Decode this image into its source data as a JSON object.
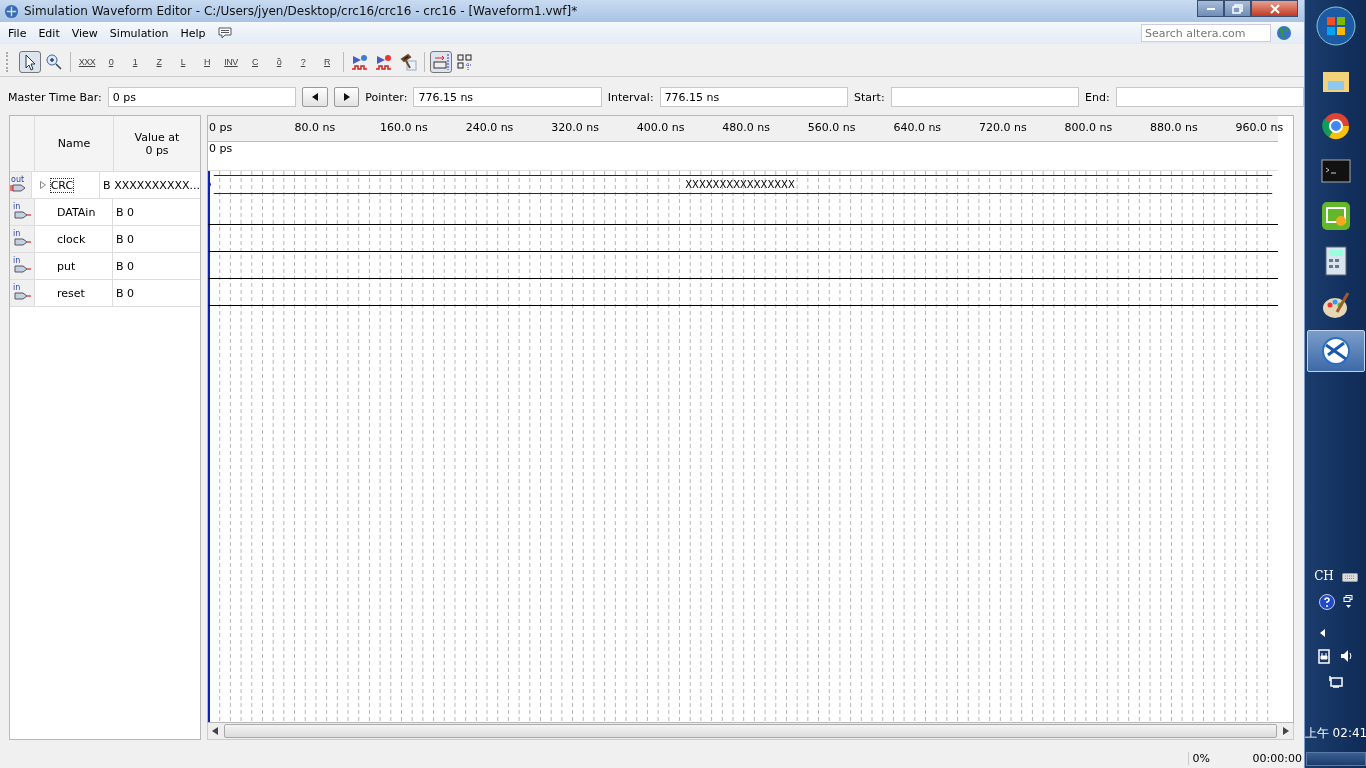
{
  "window": {
    "title": "Simulation Waveform Editor - C:/Users/jyen/Desktop/crc16/crc16 - crc16 - [Waveform1.vwf]*"
  },
  "menu": [
    "File",
    "Edit",
    "View",
    "Simulation",
    "Help"
  ],
  "search": {
    "placeholder": "Search altera.com"
  },
  "toolbar": [
    {
      "kind": "pointer",
      "selected": true
    },
    {
      "kind": "zoom",
      "selected": false
    },
    {
      "kind": "sep"
    },
    {
      "kind": "glyph",
      "glyph": "XXX",
      "selected": false
    },
    {
      "kind": "glyph",
      "glyph": "0",
      "selected": false
    },
    {
      "kind": "glyph",
      "glyph": "1",
      "selected": false
    },
    {
      "kind": "glyph",
      "glyph": "Z",
      "selected": false
    },
    {
      "kind": "glyph",
      "glyph": "L",
      "selected": false
    },
    {
      "kind": "glyph",
      "glyph": "H",
      "selected": false
    },
    {
      "kind": "glyph",
      "glyph": "INV",
      "selected": false
    },
    {
      "kind": "glyph",
      "glyph": "C",
      "selected": false
    },
    {
      "kind": "glyph",
      "glyph": "ȍ",
      "selected": false
    },
    {
      "kind": "glyph",
      "glyph": "?",
      "selected": false
    },
    {
      "kind": "glyph",
      "glyph": "R",
      "selected": false
    },
    {
      "kind": "sep"
    },
    {
      "kind": "run",
      "selected": false
    },
    {
      "kind": "run-timing",
      "selected": false
    },
    {
      "kind": "hammer",
      "selected": false
    },
    {
      "kind": "sep"
    },
    {
      "kind": "snap",
      "selected": true
    },
    {
      "kind": "grid",
      "selected": false
    }
  ],
  "timebar": {
    "master_label": "Master Time Bar:",
    "master_value": "0 ps",
    "pointer_label": "Pointer:",
    "pointer_value": "776.15 ns",
    "interval_label": "Interval:",
    "interval_value": "776.15 ns",
    "start_label": "Start:",
    "end_label": "End:"
  },
  "signals_header": {
    "name": "Name",
    "value_at": "Value at",
    "value_time": "0 ps"
  },
  "signals": [
    {
      "direction": "out",
      "name": "CRC",
      "value": "B XXXXXXXXXX...",
      "expandable": true,
      "selected": true,
      "kind": "bus",
      "wave_text": "XXXXXXXXXXXXXXXX"
    },
    {
      "direction": "in",
      "name": "DATAin",
      "value": "B 0",
      "expandable": false,
      "selected": false,
      "kind": "bit"
    },
    {
      "direction": "in",
      "name": "clock",
      "value": "B 0",
      "expandable": false,
      "selected": false,
      "kind": "bit"
    },
    {
      "direction": "in",
      "name": "put",
      "value": "B 0",
      "expandable": false,
      "selected": false,
      "kind": "bit"
    },
    {
      "direction": "in",
      "name": "reset",
      "value": "B 0",
      "expandable": false,
      "selected": false,
      "kind": "bit"
    }
  ],
  "ruler": [
    "0 ps",
    "80.0 ns",
    "160.0 ns",
    "240.0 ns",
    "320.0 ns",
    "400.0 ns",
    "480.0 ns",
    "560.0 ns",
    "640.0 ns",
    "720.0 ns",
    "800.0 ns",
    "880.0 ns",
    "960.0 ns"
  ],
  "time_marker": "0 ps",
  "status_bar": {
    "progress": "0%",
    "elapsed": "00:00:00"
  },
  "taskbar": {
    "apps": [
      {
        "kind": "folder",
        "selected": false
      },
      {
        "kind": "browser",
        "selected": false
      },
      {
        "kind": "console",
        "selected": false
      },
      {
        "kind": "video",
        "selected": false
      },
      {
        "kind": "calculator",
        "selected": false
      },
      {
        "kind": "paint",
        "selected": false
      },
      {
        "kind": "quartus",
        "selected": true
      }
    ],
    "language": "CH",
    "clock": "上午 02:41"
  }
}
